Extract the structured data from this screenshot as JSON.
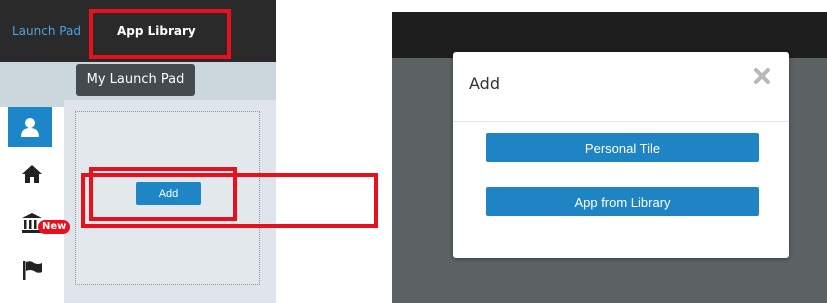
{
  "left": {
    "nav": {
      "tab_launch_pad": "Launch Pad",
      "tab_app_library": "App Library"
    },
    "tooltip": "My Launch Pad",
    "rail": {
      "items": [
        "person-icon",
        "home-icon",
        "bank-icon",
        "flag-icon"
      ],
      "new_badge": "New"
    },
    "add_button": "Add"
  },
  "right": {
    "dialog": {
      "title": "Add",
      "close_icon": "close-icon",
      "personal_tile_button": "Personal Tile",
      "app_from_library_button": "App from Library"
    }
  },
  "colors": {
    "highlight": "#e8101c",
    "primary_button": "#1e84c4",
    "nav_link": "#4ba3e0"
  }
}
